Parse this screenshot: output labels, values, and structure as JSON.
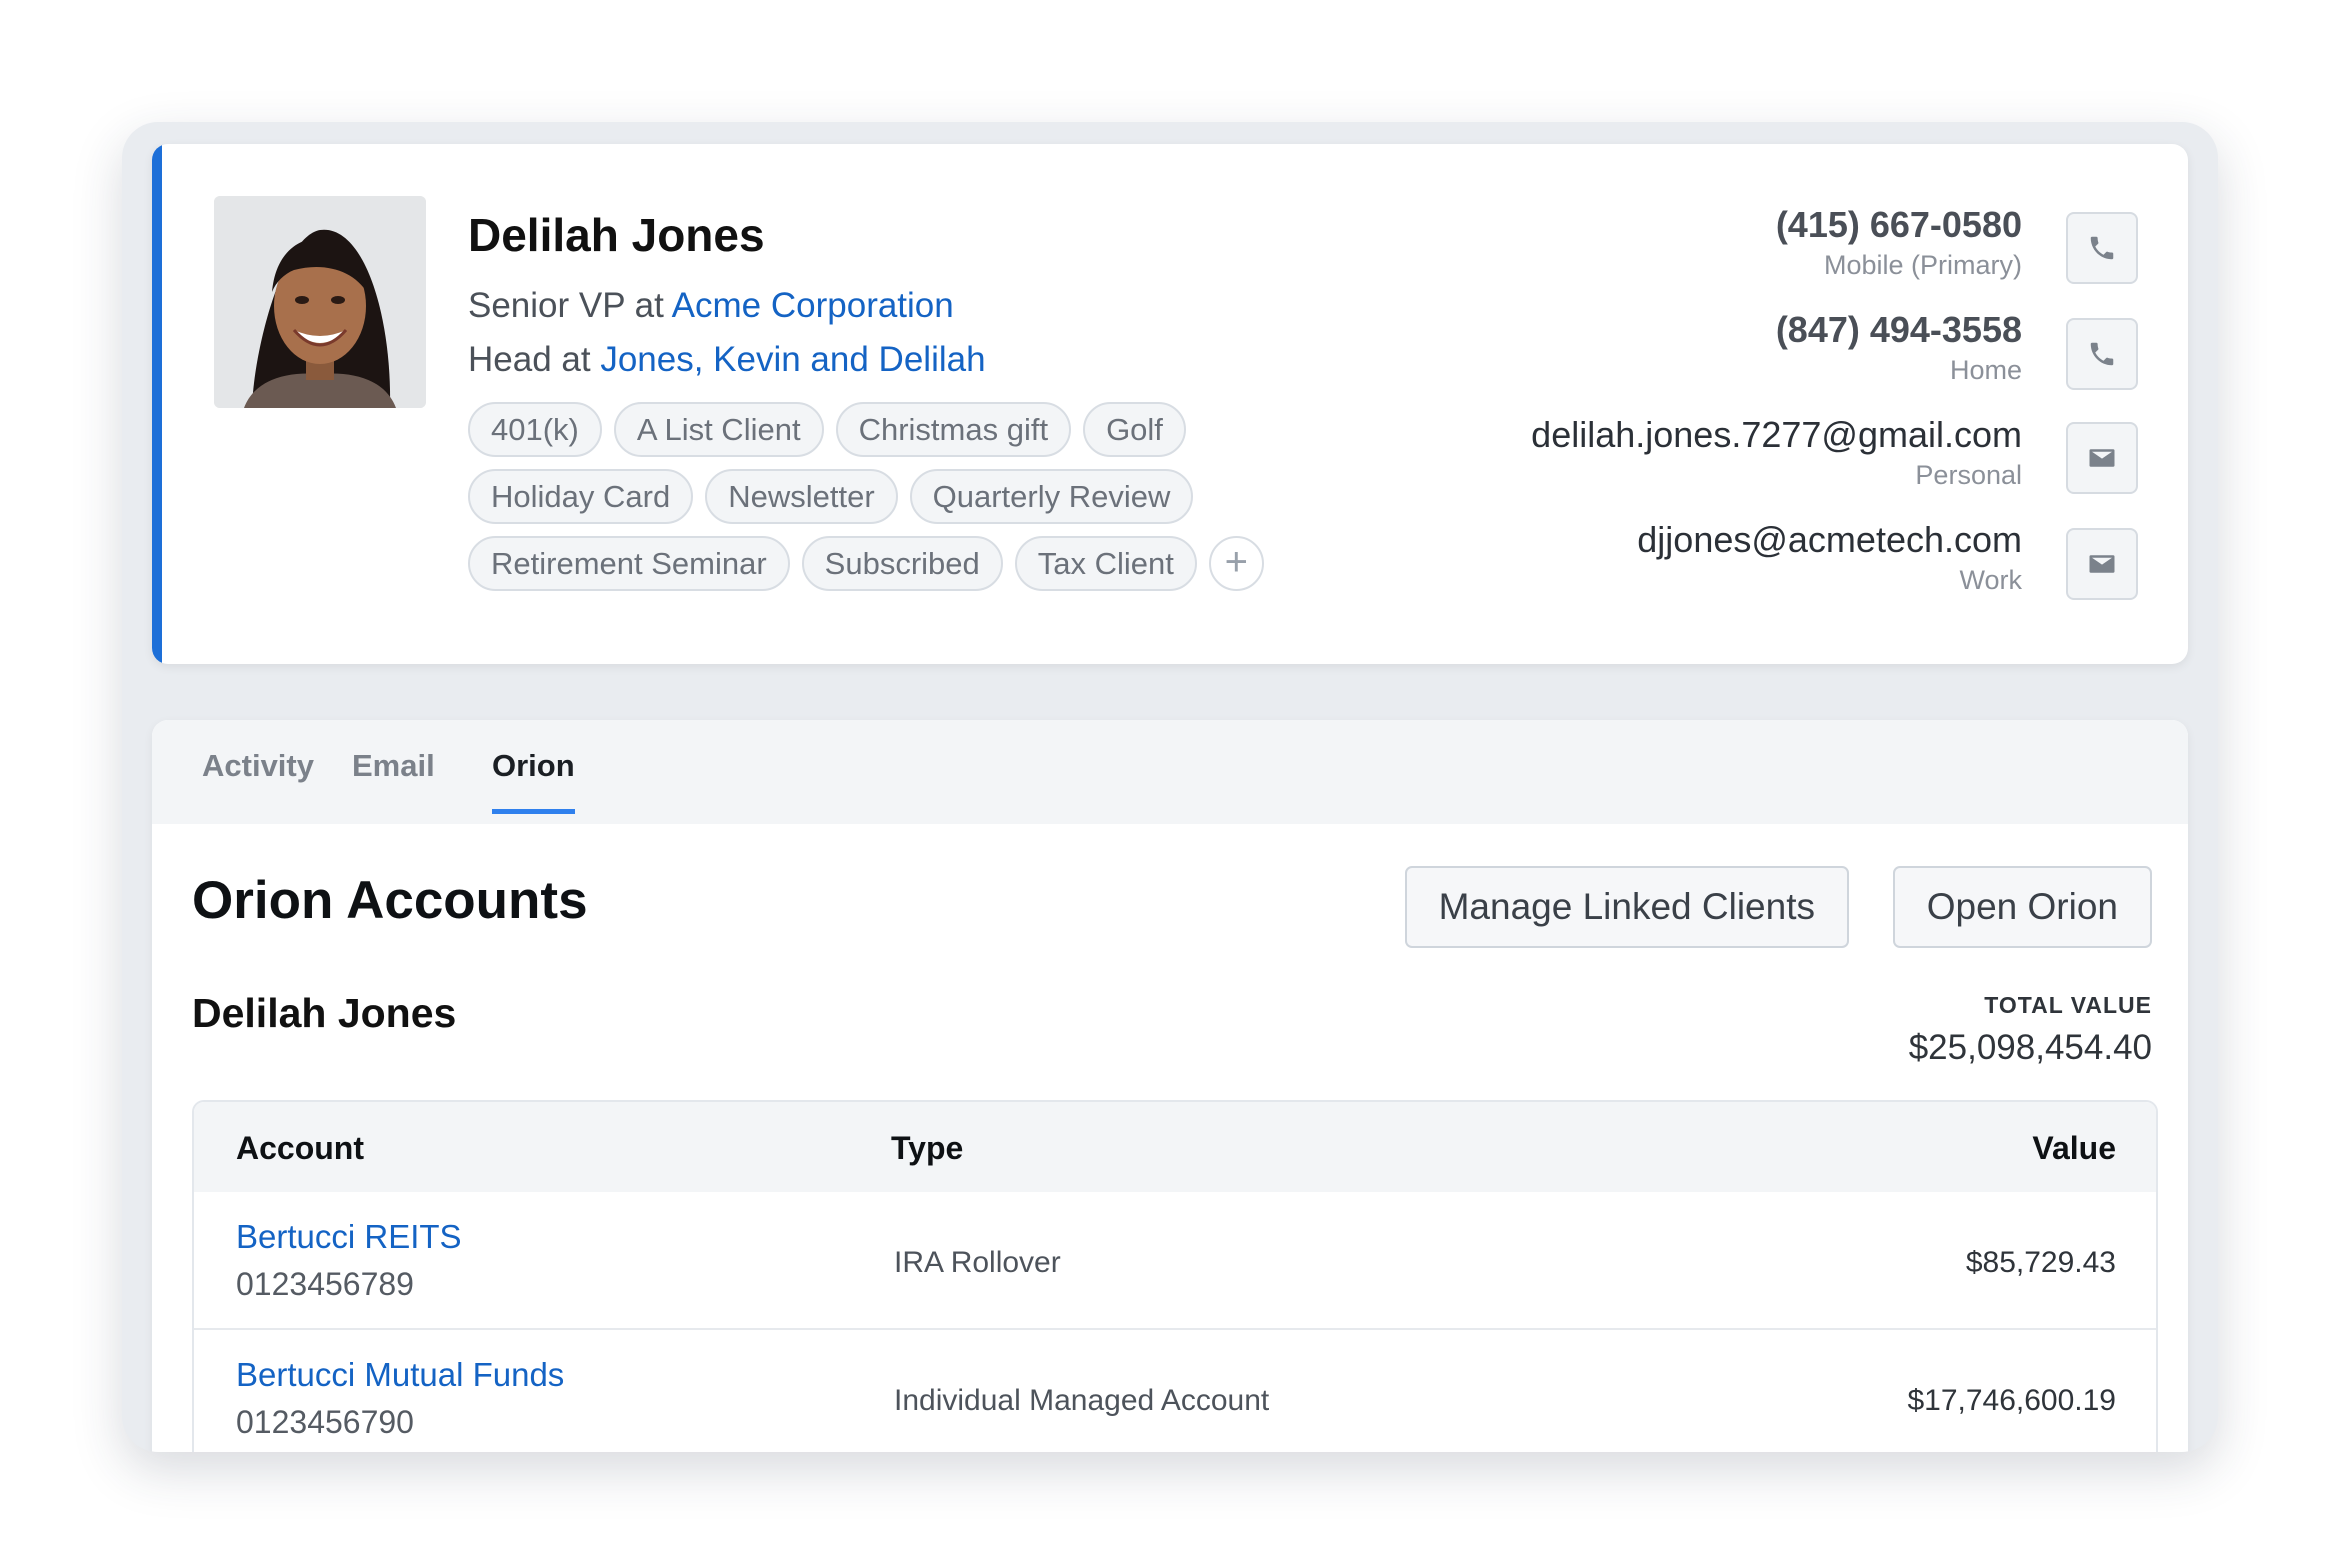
{
  "contact": {
    "name": "Delilah Jones",
    "role1": {
      "prefix": "Senior VP at ",
      "link": "Acme Corporation"
    },
    "role2": {
      "prefix": "Head at ",
      "link": "Jones, Kevin and Delilah"
    },
    "tags": [
      [
        "401(k)",
        "A List Client",
        "Christmas gift",
        "Golf"
      ],
      [
        "Holiday Card",
        "Newsletter",
        "Quarterly Review"
      ],
      [
        "Retirement Seminar",
        "Subscribed",
        "Tax Client"
      ]
    ],
    "methods": [
      {
        "value": "(415) 667-0580",
        "label": "Mobile (Primary)",
        "icon": "phone-icon"
      },
      {
        "value": "(847) 494-3558",
        "label": "Home",
        "icon": "phone-icon"
      },
      {
        "value": "delilah.jones.7277@gmail.com",
        "label": "Personal",
        "icon": "mail-icon"
      },
      {
        "value": "djjones@acmetech.com",
        "label": "Work",
        "icon": "mail-icon"
      }
    ]
  },
  "tabs": [
    "Activity",
    "Email",
    "Orion"
  ],
  "active_tab": "Orion",
  "orion": {
    "title": "Orion Accounts",
    "manage_button": "Manage Linked Clients",
    "open_button": "Open Orion",
    "client_name": "Delilah Jones",
    "total_label": "TOTAL VALUE",
    "total_value": "$25,098,454.40",
    "columns": {
      "account": "Account",
      "type": "Type",
      "value": "Value"
    },
    "accounts": [
      {
        "name": "Bertucci REITS",
        "number": "0123456789",
        "type": "IRA Rollover",
        "value": "$85,729.43"
      },
      {
        "name": "Bertucci Mutual Funds",
        "number": "0123456790",
        "type": "Individual Managed Account",
        "value": "$17,746,600.19"
      }
    ]
  },
  "colors": {
    "accent": "#1d6fd8",
    "link": "#1463c4",
    "tab_indicator": "#2f80ed"
  }
}
